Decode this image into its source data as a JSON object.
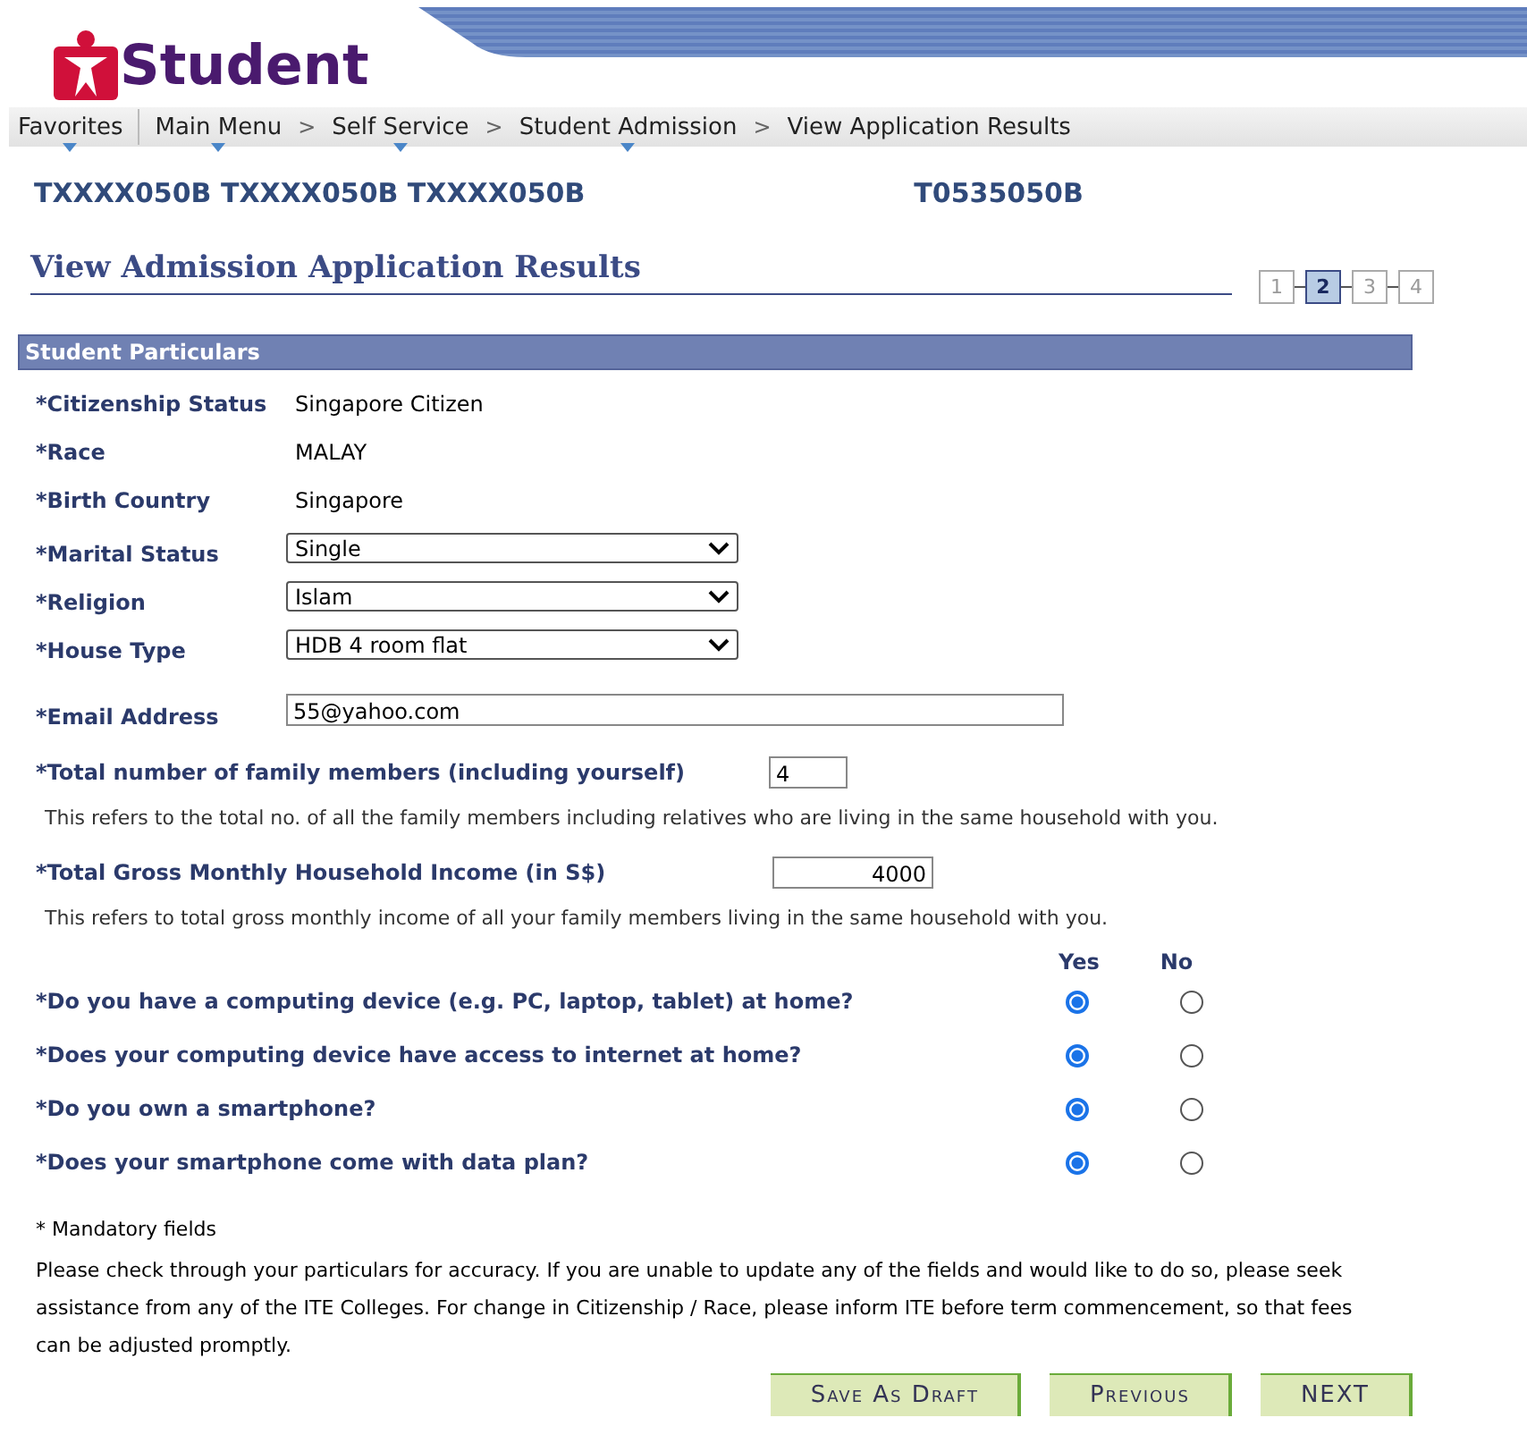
{
  "header": {
    "logo_text": "Student"
  },
  "breadcrumb": [
    {
      "label": "Favorites",
      "dropdown": true
    },
    {
      "label": "Main Menu",
      "dropdown": true,
      "divider": true
    },
    {
      "label": "Self Service",
      "dropdown": true,
      "separator": ">"
    },
    {
      "label": "Student Admission",
      "dropdown": true,
      "separator": ">"
    },
    {
      "label": "View Application Results",
      "dropdown": false,
      "separator": ">"
    }
  ],
  "ids": [
    "TXXXX050B TXXXX050B TXXXX050B",
    "T0535050B"
  ],
  "page_title": "View Admission Application Results",
  "steps": [
    {
      "label": "1",
      "selected": false
    },
    {
      "label": "2",
      "selected": true
    },
    {
      "label": "3",
      "selected": false
    },
    {
      "label": "4",
      "selected": false
    }
  ],
  "section": {
    "title": "Student Particulars"
  },
  "particulars": [
    {
      "kind": "text",
      "label": "*Citizenship Status",
      "value": "Singapore Citizen"
    },
    {
      "kind": "text",
      "label": "*Race",
      "value": "MALAY"
    },
    {
      "kind": "text",
      "label": "*Birth Country",
      "value": "Singapore"
    },
    {
      "kind": "select",
      "label": "*Marital Status",
      "value": "Single"
    },
    {
      "kind": "select",
      "label": "*Religion",
      "value": "Islam"
    },
    {
      "kind": "select",
      "label": "*House Type",
      "value": "HDB 4 room flat"
    },
    {
      "kind": "input",
      "label": "*Email Address",
      "value": "55@yahoo.com"
    }
  ],
  "family": {
    "label": "*Total number of family members (including yourself)",
    "value": "4",
    "note": "This refers to the total no. of all the family members including relatives who are living in the same household with you."
  },
  "income": {
    "label": "*Total Gross Monthly Household Income (in S$)",
    "value": "4000",
    "note": "This refers to total gross monthly income of all your family members living in the same household with you."
  },
  "answer_columns": [
    "Yes",
    "No"
  ],
  "questions": [
    {
      "label": "*Do you have a computing device (e.g. PC, laptop, tablet) at home?",
      "options": [
        {
          "selected": true
        },
        {
          "selected": false
        }
      ]
    },
    {
      "label": "*Does your computing device have access to internet at home?",
      "options": [
        {
          "selected": true
        },
        {
          "selected": false
        }
      ]
    },
    {
      "label": "*Do you own a smartphone?",
      "options": [
        {
          "selected": true
        },
        {
          "selected": false
        }
      ]
    },
    {
      "label": "*Does your smartphone come with data plan?",
      "options": [
        {
          "selected": true
        },
        {
          "selected": false
        }
      ]
    }
  ],
  "footer": {
    "mandatory": "* Mandatory fields",
    "instructions": "Please check through your particulars for accuracy. If you are unable to update any of the fields and would like to do so, please seek assistance from any of the ITE Colleges. For change in Citizenship / Race, please inform ITE before term commencement, so that fees can be adjusted promptly."
  },
  "buttons": [
    {
      "label": "Save As Draft",
      "kind": "smallcaps"
    },
    {
      "label": "Previous",
      "kind": "smallcaps"
    },
    {
      "label": "NEXT",
      "kind": "plain"
    }
  ]
}
